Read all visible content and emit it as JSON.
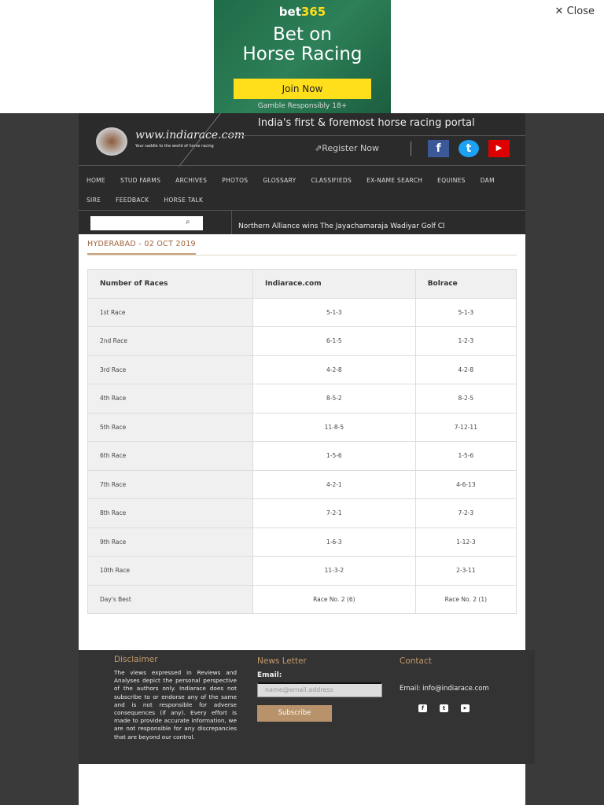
{
  "ad": {
    "brand_a": "bet",
    "brand_b": "365",
    "headline_1": "Bet on",
    "headline_2": "Horse Racing",
    "cta": "Join Now",
    "disclaimer": "Gamble Responsibly  18+",
    "close": "✕ Close"
  },
  "header": {
    "site": "www.indiarace.com",
    "tagline": "Your saddle to the world of horse racing",
    "portal": "India's first & foremost horse racing portal",
    "register": "Register Now",
    "social": [
      "f",
      "t",
      "▶"
    ]
  },
  "nav": [
    "HOME",
    "STUD FARMS",
    "ARCHIVES",
    "PHOTOS",
    "GLOSSARY",
    "CLASSIFIEDS",
    "EX-NAME SEARCH",
    "EQUINES",
    "DAM",
    "SIRE",
    "FEEDBACK",
    "HORSE TALK"
  ],
  "search": {
    "placeholder": "",
    "icon": "🔍"
  },
  "ticker": "Northern Alliance wins The Jayachamaraja Wadiyar Golf Cl",
  "page": {
    "title": "HYDERABAD - 02 OCT 2019"
  },
  "table": {
    "headers": [
      "Number of Races",
      "Indiarace.com",
      "Bolrace"
    ],
    "rows": [
      [
        "1st Race",
        "5-1-3",
        "5-1-3"
      ],
      [
        "2nd Race",
        "6-1-5",
        "1-2-3"
      ],
      [
        "3rd Race",
        "4-2-8",
        "4-2-8"
      ],
      [
        "4th Race",
        "8-5-2",
        "8-2-5"
      ],
      [
        "5th Race",
        "11-8-5",
        "7-12-11"
      ],
      [
        "6th Race",
        "1-5-6",
        "1-5-6"
      ],
      [
        "7th Race",
        "4-2-1",
        "4-6-13"
      ],
      [
        "8th Race",
        "7-2-1",
        "7-2-3"
      ],
      [
        "9th Race",
        "1-6-3",
        "1-12-3"
      ],
      [
        "10th Race",
        "11-3-2",
        "2-3-11"
      ],
      [
        "Day's Best",
        "Race No. 2 (6)",
        "Race No. 2 (1)"
      ]
    ]
  },
  "footer": {
    "disclaimer_title": "Disclaimer",
    "disclaimer": "The views expressed in Reviews and Analyses depict the personal perspective of the authors only. Indiarace does not subscribe to or endorse any of the same and is not responsible for adverse consequences (if any). Every effort is made to provide accurate information, we are not responsible for any discrepancies that are beyond our control.",
    "newsletter_title": "News Letter",
    "email_label": "Email:",
    "email_placeholder": "name@email.address",
    "subscribe": "Subscribe",
    "contact_title": "Contact",
    "contact_email": "Email: info@indiarace.com",
    "social": [
      "f",
      "t",
      "▶"
    ]
  }
}
